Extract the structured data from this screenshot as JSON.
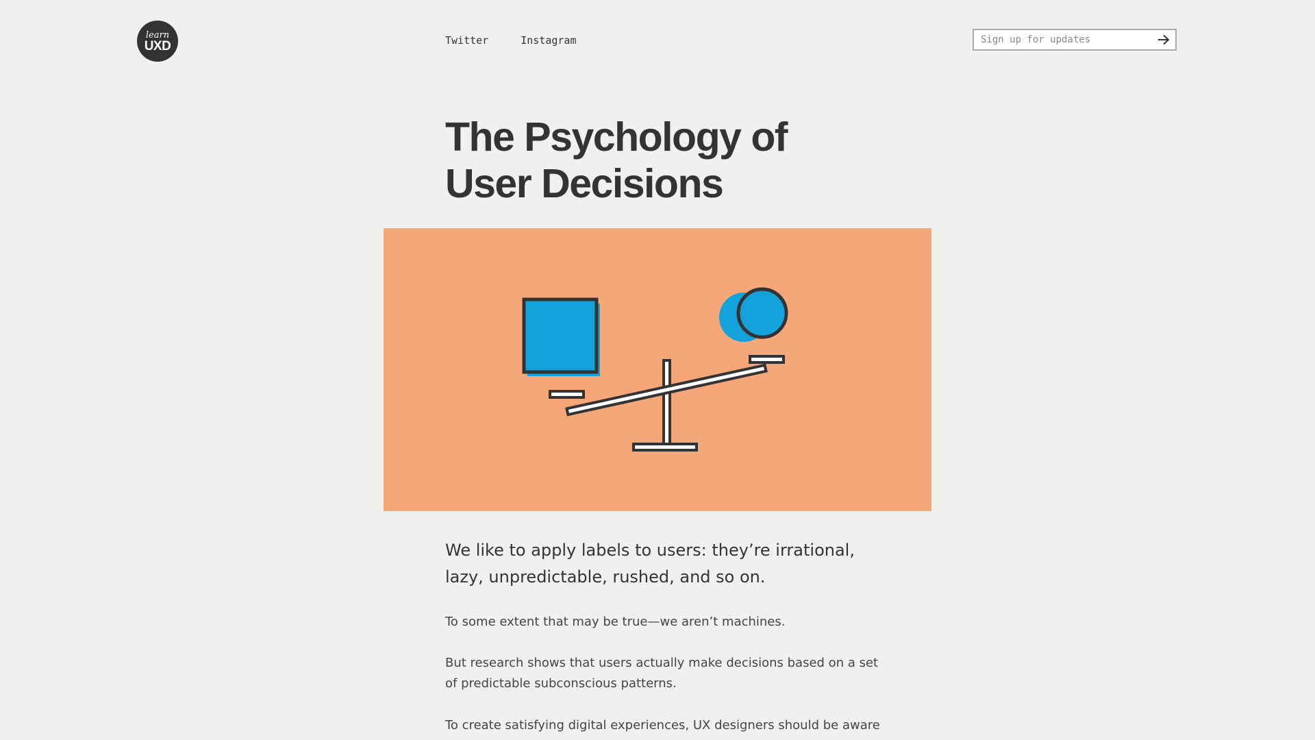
{
  "header": {
    "logo": {
      "line1": "learn",
      "line2": "UXD"
    },
    "nav": [
      {
        "label": "Twitter"
      },
      {
        "label": "Instagram"
      }
    ],
    "signup": {
      "placeholder": "Sign up for updates",
      "value": "",
      "submit_icon": "arrow-right-icon"
    }
  },
  "article": {
    "title_line1": "The Psychology of",
    "title_line2": "User Decisions",
    "hero": {
      "background": "#f5a77a",
      "accent": "#12a3dc",
      "stroke": "#333333",
      "icons": [
        "square-weight-icon",
        "circle-weight-icon",
        "seesaw-icon"
      ]
    },
    "lead": "We like to apply labels to users: they’re irrational, lazy, unpredictable, rushed, and so on.",
    "paragraphs": [
      "To some extent that may be true—we aren’t machines.",
      "But research shows that users actually make decisions based on a set of predictable subconscious patterns.",
      "To create satisfying digital experiences, UX designers should be aware of"
    ]
  }
}
